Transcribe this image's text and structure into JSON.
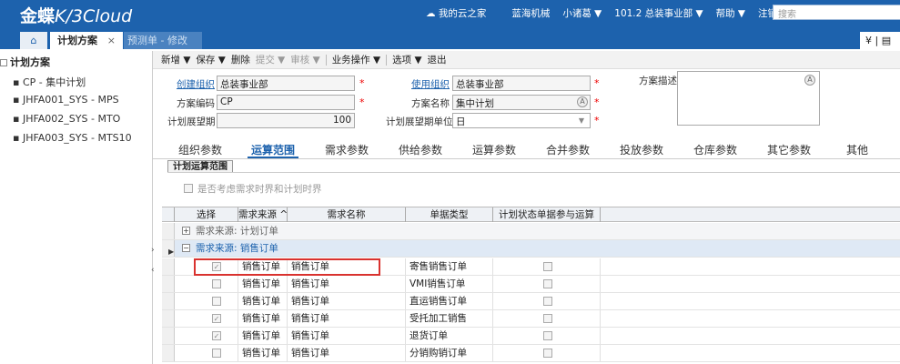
{
  "header": {
    "logo_main": "金蝶",
    "logo_k3": "K/3",
    "logo_cloud": "Cloud",
    "nav": [
      "我的云之家",
      "蓝海机械",
      "小诸葛 ▼",
      "101.2 总装事业部 ▼",
      "帮助 ▼",
      "注销"
    ],
    "search_placeholder": "搜索"
  },
  "tabs": {
    "home_icon": "home-icon",
    "active": "计划方案",
    "active_close": "×",
    "other": "预测单 - 修改",
    "tools": "¥ | ▤"
  },
  "left_panel": {
    "title": "计划方案",
    "items": [
      "CP - 集中计划",
      "JHFA001_SYS - MPS",
      "JHFA002_SYS - MTO",
      "JHFA003_SYS - MTS10"
    ]
  },
  "toolbar": {
    "items": [
      "新增 ▼",
      "保存 ▼",
      "删除",
      "提交 ▼",
      "审核 ▼",
      "业务操作 ▼",
      "选项 ▼",
      "退出"
    ]
  },
  "form": {
    "create_org_label": "创建组织",
    "create_org_value": "总装事业部",
    "use_org_label": "使用组织",
    "use_org_value": "总装事业部",
    "plan_desc_label": "方案描述",
    "plan_code_label": "方案编码",
    "plan_code_value": "CP",
    "plan_name_label": "方案名称",
    "plan_name_value": "集中计划",
    "horizon_label": "计划展望期",
    "horizon_value": "100",
    "horizon_unit_label": "计划展望期单位",
    "horizon_unit_value": "日",
    "required_mark": "*"
  },
  "section_tabs": {
    "items": [
      "组织参数",
      "运算范围",
      "需求参数",
      "供给参数",
      "运算参数",
      "合并参数",
      "投放参数",
      "仓库参数",
      "其它参数",
      "其他"
    ],
    "active_index": 1,
    "subtab": "计划运算范围"
  },
  "option": {
    "label": "是否考虑需求时界和计划时界"
  },
  "grid": {
    "headers": [
      "选择",
      "需求来源 ^",
      "需求名称",
      "单据类型",
      "计划状态单据参与运算"
    ],
    "groups": [
      {
        "label": "需求来源: 计划订单",
        "expander": "+"
      },
      {
        "label": "需求来源: 销售订单",
        "expander": "−"
      }
    ],
    "rows": [
      {
        "selected": true,
        "source": "销售订单",
        "name": "销售订单",
        "doctype": "寄售销售订单"
      },
      {
        "selected": false,
        "source": "销售订单",
        "name": "销售订单",
        "doctype": "VMI销售订单"
      },
      {
        "selected": false,
        "source": "销售订单",
        "name": "销售订单",
        "doctype": "直运销售订单"
      },
      {
        "selected": true,
        "source": "销售订单",
        "name": "销售订单",
        "doctype": "受托加工销售"
      },
      {
        "selected": true,
        "source": "销售订单",
        "name": "销售订单",
        "doctype": "退货订单"
      },
      {
        "selected": false,
        "source": "销售订单",
        "name": "销售订单",
        "doctype": "分销购销订单"
      }
    ]
  }
}
